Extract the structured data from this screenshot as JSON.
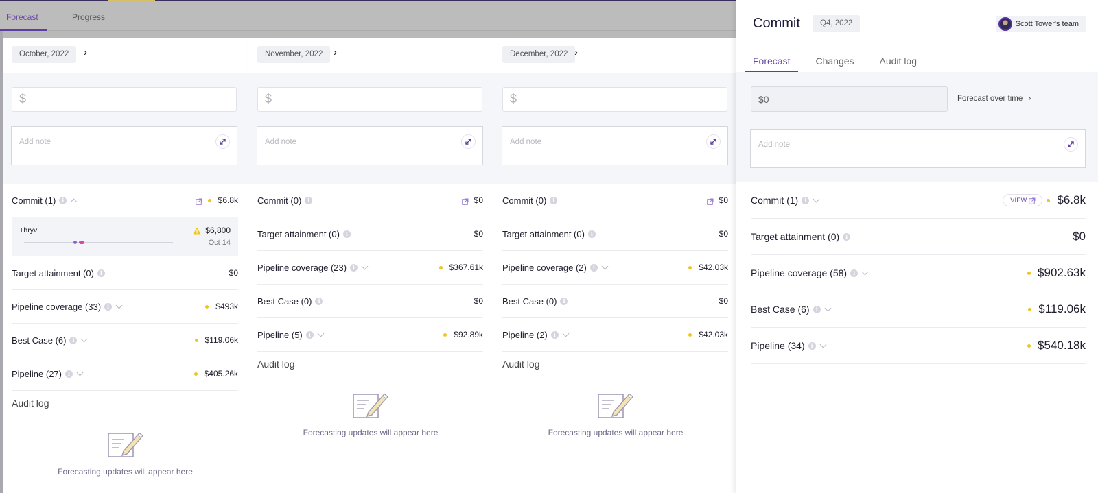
{
  "top_tabs": [
    {
      "label": "Forecast",
      "active": true
    },
    {
      "label": "Progress",
      "active": false
    }
  ],
  "colors": {
    "accent": "#5b3ea0",
    "dot_yellow": "#f0c419",
    "deal_dot_purple": "#8a5fd0",
    "deal_dot_pink": "#d04aa6"
  },
  "columns": [
    {
      "month": "October, 2022",
      "amount_placeholder": "$",
      "note_placeholder": "Add note",
      "rows": [
        {
          "label": "Commit (1)",
          "value": "$6.8k",
          "dot": true,
          "ext": true,
          "chevron": "up"
        },
        {
          "label": "Target attainment (0)",
          "value": "$0",
          "dot": false,
          "ext": false,
          "chevron": ""
        },
        {
          "label": "Pipeline coverage (33)",
          "value": "$493k",
          "dot": true,
          "ext": false,
          "chevron": "down"
        },
        {
          "label": "Best Case (6)",
          "value": "$119.06k",
          "dot": true,
          "ext": false,
          "chevron": "down"
        },
        {
          "label": "Pipeline (27)",
          "value": "$405.26k",
          "dot": true,
          "ext": false,
          "chevron": "down"
        }
      ],
      "deal": {
        "name": "Thryv",
        "amount": "$6,800",
        "date": "Oct 14"
      },
      "audit_title": "Audit log",
      "empty_text": "Forecasting updates will appear here"
    },
    {
      "month": "November, 2022",
      "amount_placeholder": "$",
      "note_placeholder": "Add note",
      "rows": [
        {
          "label": "Commit (0)",
          "value": "$0",
          "dot": false,
          "ext": true,
          "chevron": ""
        },
        {
          "label": "Target attainment (0)",
          "value": "$0",
          "dot": false,
          "ext": false,
          "chevron": ""
        },
        {
          "label": "Pipeline coverage (23)",
          "value": "$367.61k",
          "dot": true,
          "ext": false,
          "chevron": "down"
        },
        {
          "label": "Best Case (0)",
          "value": "$0",
          "dot": false,
          "ext": false,
          "chevron": ""
        },
        {
          "label": "Pipeline (5)",
          "value": "$92.89k",
          "dot": true,
          "ext": false,
          "chevron": "down"
        }
      ],
      "audit_title": "Audit log",
      "empty_text": "Forecasting updates will appear here"
    },
    {
      "month": "December, 2022",
      "amount_placeholder": "$",
      "note_placeholder": "Add note",
      "rows": [
        {
          "label": "Commit (0)",
          "value": "$0",
          "dot": false,
          "ext": true,
          "chevron": ""
        },
        {
          "label": "Target attainment (0)",
          "value": "$0",
          "dot": false,
          "ext": false,
          "chevron": ""
        },
        {
          "label": "Pipeline coverage (2)",
          "value": "$42.03k",
          "dot": true,
          "ext": false,
          "chevron": "down"
        },
        {
          "label": "Best Case (0)",
          "value": "$0",
          "dot": false,
          "ext": false,
          "chevron": ""
        },
        {
          "label": "Pipeline (2)",
          "value": "$42.03k",
          "dot": true,
          "ext": false,
          "chevron": "down"
        }
      ],
      "audit_title": "Audit log",
      "empty_text": "Forecasting updates will appear here"
    }
  ],
  "panel": {
    "title": "Commit",
    "quarter": "Q4, 2022",
    "team": "Scott Tower's team",
    "tabs": [
      {
        "label": "Forecast",
        "active": true
      },
      {
        "label": "Changes",
        "active": false
      },
      {
        "label": "Audit log",
        "active": false
      }
    ],
    "amount_value": "$0",
    "forecast_over_time": "Forecast over time",
    "note_placeholder": "Add note",
    "view_label": "VIEW",
    "rows": [
      {
        "label": "Commit (1)",
        "value": "$6.8k",
        "dot": true,
        "view": true,
        "chevron": "down"
      },
      {
        "label": "Target attainment (0)",
        "value": "$0",
        "dot": false,
        "view": false,
        "chevron": ""
      },
      {
        "label": "Pipeline coverage (58)",
        "value": "$902.63k",
        "dot": true,
        "view": false,
        "chevron": "down"
      },
      {
        "label": "Best Case (6)",
        "value": "$119.06k",
        "dot": true,
        "view": false,
        "chevron": "down"
      },
      {
        "label": "Pipeline (34)",
        "value": "$540.18k",
        "dot": true,
        "view": false,
        "chevron": "down"
      }
    ]
  }
}
